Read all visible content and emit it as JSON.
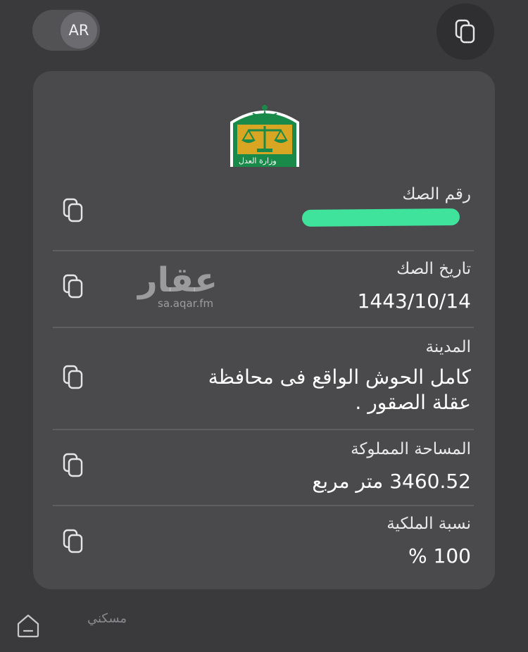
{
  "header": {
    "lang_toggle_label": "AR",
    "copy_icon": "copy-icon"
  },
  "card": {
    "emblem": {
      "icon": "ministry-of-justice-emblem",
      "text": "وزارة العدل"
    },
    "fields": [
      {
        "label": "رقم الصك",
        "value": "",
        "redacted": true
      },
      {
        "label": "تاريخ الصك",
        "value": "1443/10/14"
      },
      {
        "label": "المدينة",
        "value": "كامل الحوش الواقع فى محافظة عقلة الصقور ."
      },
      {
        "label": "المساحة المملوكة",
        "value": "3460.52 متر مربع"
      },
      {
        "label": "نسبة الملكية",
        "value": "100 %"
      }
    ]
  },
  "watermark": {
    "main": "عقار",
    "sub": "sa.aqar.fm"
  },
  "bottom_bar": {
    "home_icon": "home-icon",
    "label": "مسكني"
  },
  "colors": {
    "background": "#3a3a3c",
    "card": "#4a4a4d",
    "redaction": "#3fe39b",
    "emblem_green": "#1a8a4a",
    "emblem_gold": "#d9a623"
  }
}
